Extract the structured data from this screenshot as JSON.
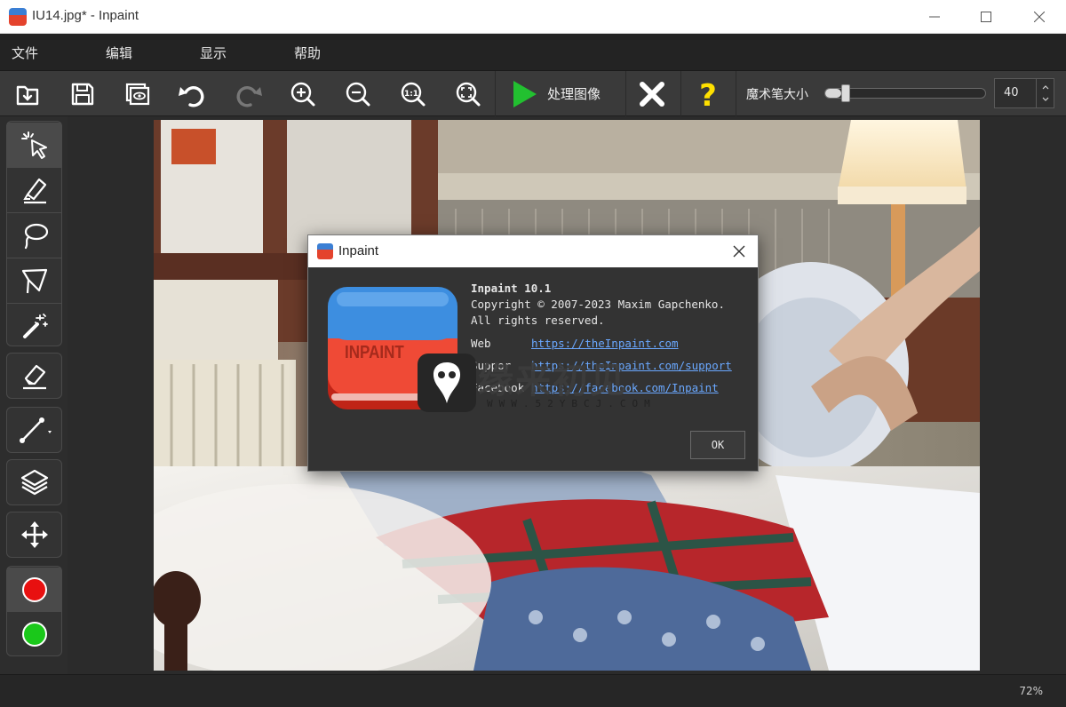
{
  "window": {
    "title": "IU14.jpg* - Inpaint",
    "controls": [
      "minimize",
      "maximize",
      "close"
    ]
  },
  "menu": {
    "items": [
      {
        "label": "文件"
      },
      {
        "label": "编辑"
      },
      {
        "label": "显示"
      },
      {
        "label": "帮助"
      }
    ]
  },
  "toolbar": {
    "buttons": [
      "open-icon",
      "save-icon",
      "preview-icon",
      "undo-icon",
      "redo-icon",
      "zoom-in-icon",
      "zoom-out-icon",
      "zoom-actual-icon",
      "zoom-fit-icon"
    ],
    "process_label": "处理图像",
    "brush_size_label": "魔术笔大小",
    "brush_size_value": "40",
    "brush_size_fraction": 0.1,
    "accent_play": "#22c030",
    "accent_help": "#ffe000"
  },
  "tools": {
    "items": [
      "magic-select-icon",
      "marker-icon",
      "lasso-icon",
      "polygon-lasso-icon",
      "magic-wand-icon",
      "eraser-icon",
      "line-icon",
      "layers-icon",
      "move-icon"
    ],
    "colors": [
      "#e81010",
      "#1ac81a"
    ]
  },
  "status": {
    "zoom": "72%"
  },
  "about_dialog": {
    "title": "Inpaint",
    "logo_text": "INPAINT",
    "product": "Inpaint 10.1",
    "copyright": "Copyright © 2007-2023 Maxim Gapchenko.",
    "rights": "All rights reserved.",
    "web_label": "Web",
    "web_url": "https://theInpaint.com",
    "support_label": "Suppor",
    "support_url": "https://theInpaint.com/support",
    "facebook_label": "Facebook",
    "facebook_url": "https://facebook.com/Inpaint",
    "ok_label": "OK"
  },
  "watermark": {
    "text": "缘来初见",
    "sub": "WWW.52YBCJ.COM"
  }
}
